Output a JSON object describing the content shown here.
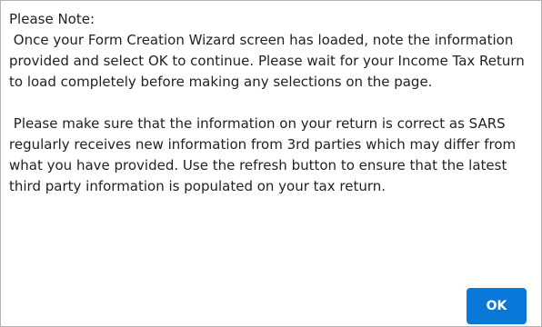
{
  "dialog": {
    "heading": "Please Note:",
    "paragraph_1": " Once your Form Creation Wizard screen has loaded, note the information provided and select OK to continue. Please wait for your Income Tax Return to load completely before making any selections on the page.",
    "paragraph_2": " Please make sure that the information on your return is correct as SARS regularly receives new information from 3rd parties which may differ from what you have provided. Use the refresh button to ensure that the latest third party information is populated on your tax return.",
    "ok_label": "OK"
  },
  "colors": {
    "button_bg": "#0a78d8",
    "button_text": "#ffffff",
    "text": "#222222",
    "border": "#b3b3b3"
  }
}
